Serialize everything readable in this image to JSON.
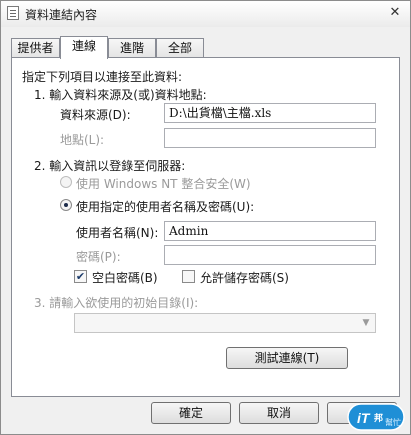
{
  "window": {
    "title": "資料連結內容",
    "close_glyph": "✕"
  },
  "tabs": [
    {
      "label": "提供者",
      "active": false
    },
    {
      "label": "連線",
      "active": true
    },
    {
      "label": "進階",
      "active": false
    },
    {
      "label": "全部",
      "active": false
    }
  ],
  "connection": {
    "intro": "指定下列項目以連接至此資料:",
    "step1": {
      "heading": "1. 輸入資料來源及(或)資料地點:",
      "source_label": "資料來源(D):",
      "source_value": "D:\\出貨檔\\主檔.xls",
      "location_label": "地點(L):",
      "location_value": ""
    },
    "step2": {
      "heading": "2. 輸入資訊以登錄至伺服器:",
      "nt_security_label": "使用 Windows NT 整合安全(W)",
      "specific_user_label": "使用指定的使用者名稱及密碼(U):",
      "username_label": "使用者名稱(N):",
      "username_value": "Admin",
      "password_label": "密碼(P):",
      "password_value": "",
      "blank_password_label": "空白密碼(B)",
      "allow_save_password_label": "允許儲存密碼(S)"
    },
    "step3": {
      "heading": "3. 請輸入欲使用的初始目錄(I):",
      "catalog_value": ""
    },
    "test_button": "測試連線(T)"
  },
  "footer": {
    "ok_button": "確定",
    "cancel_button": "取消",
    "help_button": "說明"
  },
  "watermark": {
    "text": "iT邦幫忙",
    "icon": "it-bang-logo"
  },
  "colors": {
    "watermark_blue": "#1f8fd6",
    "watermark_dark": "#0b5fa8"
  }
}
